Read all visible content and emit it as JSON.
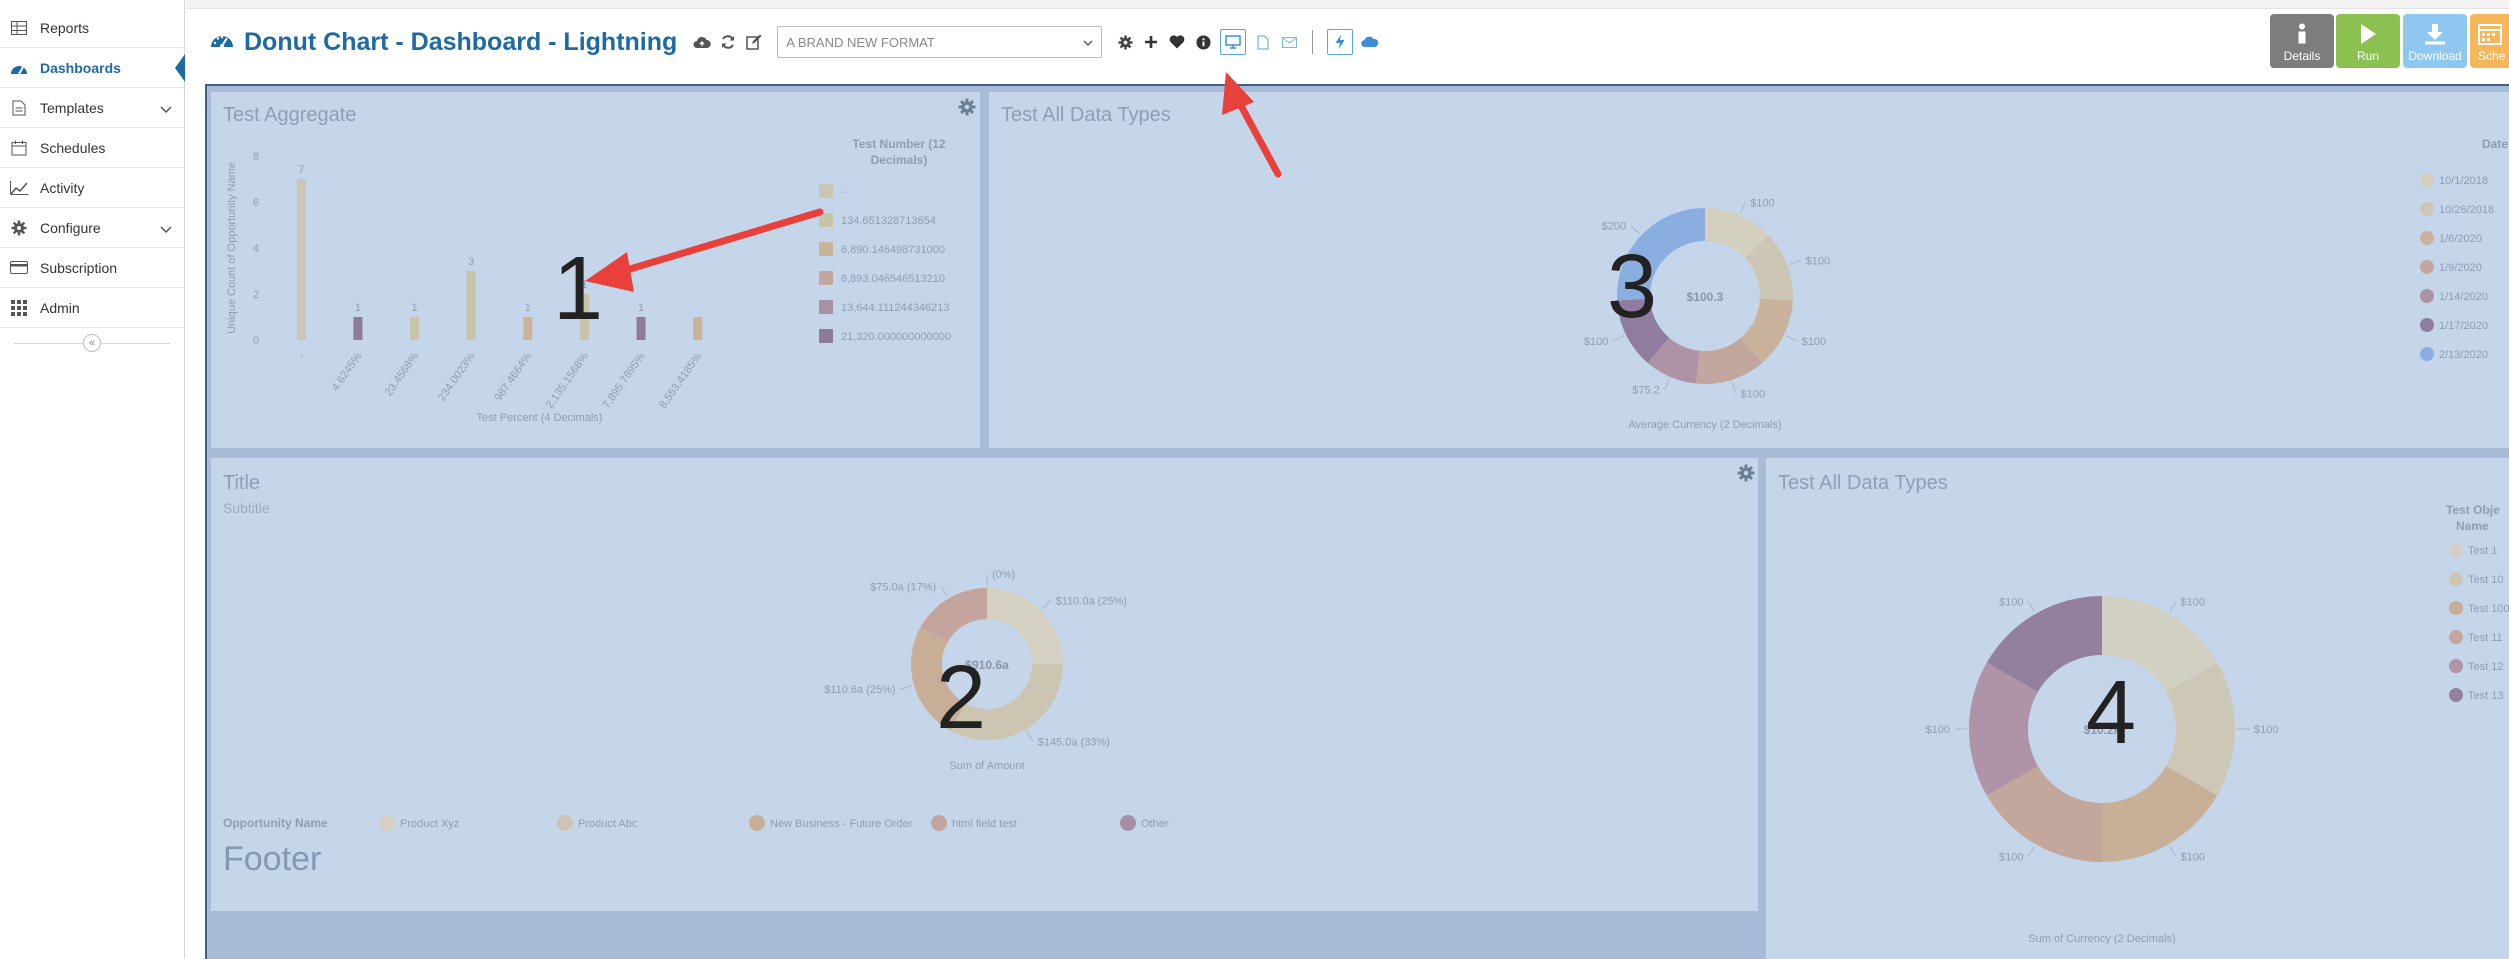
{
  "sidebar": {
    "items": [
      {
        "label": "Reports",
        "icon": "table-icon"
      },
      {
        "label": "Dashboards",
        "icon": "dashboard-icon",
        "active": true
      },
      {
        "label": "Templates",
        "icon": "document-icon",
        "expandable": true
      },
      {
        "label": "Schedules",
        "icon": "calendar-icon"
      },
      {
        "label": "Activity",
        "icon": "line-chart-icon"
      },
      {
        "label": "Configure",
        "icon": "gear-icon",
        "expandable": true
      },
      {
        "label": "Subscription",
        "icon": "credit-card-icon"
      },
      {
        "label": "Admin",
        "icon": "grid-icon"
      }
    ],
    "collapse_glyph": "«"
  },
  "header": {
    "title": "Donut Chart - Dashboard - Lightning",
    "format_select": {
      "value": "A BRAND NEW FORMAT"
    }
  },
  "actions": {
    "details": {
      "label": "Details",
      "color": "#7d7d7d"
    },
    "run": {
      "label": "Run",
      "color": "#8cc152"
    },
    "download": {
      "label": "Download",
      "color": "#8ec7ef"
    },
    "schedule": {
      "label": "Sche",
      "color": "#f5b75a"
    }
  },
  "colors": {
    "accent": "#1f6aa5",
    "dashboard_bg": "#a9bcd7",
    "panel_bg": "#c6d6ea",
    "annotation_arrow": "#e8403a"
  },
  "panels": {
    "p1": {
      "title": "Test Aggregate",
      "ylabel": "Unique Count of Opportunity Name",
      "xlabel": "Test Percent (4 Decimals)",
      "legend_title": "Test Number (12 Decimals)",
      "annotation": "1"
    },
    "p2": {
      "title": "Test All Data Types",
      "center_label": "$100.3",
      "xlabel": "Average Currency (2 Decimals)",
      "legend_title": "Date",
      "annotation": "3"
    },
    "p3": {
      "title": "Title",
      "subtitle": "Subtitle",
      "center_label": "$910.6a",
      "xlabel": "Sum of Amount",
      "legend_title": "Opportunity Name",
      "footer": "Footer",
      "annotation": "2"
    },
    "p4": {
      "title": "Test All Data Types",
      "center_label": "$10.2k",
      "xlabel": "Sum of Currency (2 Decimals)",
      "legend_title": "Test Obje Name",
      "annotation": "4"
    }
  },
  "chart_data": [
    {
      "type": "bar",
      "title": "Test Aggregate",
      "ylabel": "Unique Count of Opportunity Name",
      "xlabel": "Test Percent (4 Decimals)",
      "ylim": [
        0,
        8
      ],
      "yticks": [
        "0",
        "2",
        "4",
        "6",
        "8"
      ],
      "categories": [
        "-",
        "4.6245%",
        "23.4568%",
        "234.0023%",
        "987.4664%",
        "2,135.1568%",
        "7,895.7895%",
        "8,553.4185%"
      ],
      "series": [
        {
          "name": "-",
          "color": "#c9c7b3",
          "values": [
            7,
            0,
            0,
            0,
            0,
            0,
            0,
            0
          ]
        },
        {
          "name": "134.651328713654",
          "color": "#c8c4a8",
          "values": [
            0,
            0,
            1,
            3,
            0,
            2,
            0,
            0
          ]
        },
        {
          "name": "6,890.146498731000",
          "color": "#c9b49a",
          "values": [
            0,
            0,
            0,
            0,
            1,
            0,
            0,
            1
          ]
        },
        {
          "name": "6,893.046546513210",
          "color": "#c3a79e",
          "values": [
            0,
            0,
            0,
            0,
            0,
            0,
            0,
            0
          ]
        },
        {
          "name": "13,644.111244346213",
          "color": "#a890a6",
          "values": [
            0,
            0,
            0,
            0,
            0,
            0,
            0,
            0
          ]
        },
        {
          "name": "21,320.000000000000",
          "color": "#8e7b9c",
          "values": [
            0,
            1,
            0,
            0,
            0,
            0,
            1,
            0
          ]
        }
      ],
      "data_labels": [
        "7",
        "1",
        "1",
        "3",
        "1",
        "1",
        "1"
      ],
      "legend": "right"
    },
    {
      "type": "pie",
      "donut": true,
      "title": "Test All Data Types",
      "xlabel": "Average Currency (2 Decimals)",
      "center_label": "$100.3",
      "legend_title": "Date",
      "slices": [
        {
          "name": "10/1/2018",
          "label": "$100",
          "value": 100,
          "color": "#d4d0c0"
        },
        {
          "name": "10/26/2018",
          "label": "$100",
          "value": 100,
          "color": "#cec6b4"
        },
        {
          "name": "1/6/2020",
          "label": "$100",
          "value": 100,
          "color": "#c9b39c"
        },
        {
          "name": "1/9/2020",
          "label": "$100",
          "value": 100,
          "color": "#c3a79e"
        },
        {
          "name": "1/14/2020",
          "label": "$75.2",
          "value": 75.2,
          "color": "#ad93a5"
        },
        {
          "name": "1/17/2020",
          "label": "$100",
          "value": 100,
          "color": "#8f7c9e"
        },
        {
          "name": "2/13/2020",
          "label": "$200",
          "value": 200,
          "color": "#8aaee0"
        }
      ],
      "legend": "right"
    },
    {
      "type": "pie",
      "donut": true,
      "title": "Title",
      "subtitle": "Subtitle",
      "xlabel": "Sum of Amount",
      "center_label": "$910.6a",
      "legend_title": "Opportunity Name",
      "slices": [
        {
          "name": "Product Xyz",
          "label": "$110.0a (25%)",
          "value": 25,
          "color": "#d4d1c2"
        },
        {
          "name": "Product Abc",
          "label": "$145.0a (33%)",
          "value": 33,
          "color": "#ccc5b2"
        },
        {
          "name": "New Business - Future Order",
          "label": "$110.6a (25%)",
          "value": 25,
          "color": "#c8ae96"
        },
        {
          "name": "html field test",
          "label": "$75.0a (17%)",
          "value": 17,
          "color": "#c4a59d"
        },
        {
          "name": "Other",
          "label": "(0%)",
          "value": 0,
          "color": "#a68ea5"
        }
      ],
      "legend": "bottom"
    },
    {
      "type": "pie",
      "donut": true,
      "title": "Test All Data Types",
      "xlabel": "Sum of Currency (2 Decimals)",
      "center_label": "$10.2k",
      "legend_title": "Test Obje Name",
      "slices": [
        {
          "name": "Test 1",
          "label": "$100",
          "value": 100,
          "color": "#d2d0c3"
        },
        {
          "name": "Test 10",
          "label": "$100",
          "value": 100,
          "color": "#cdc8b6"
        },
        {
          "name": "Test 100",
          "label": "$100",
          "value": 100,
          "color": "#c8b098"
        },
        {
          "name": "Test 11",
          "label": "$100",
          "value": 100,
          "color": "#c3a69c"
        },
        {
          "name": "Test 12",
          "label": "$100",
          "value": 100,
          "color": "#ae94a6"
        },
        {
          "name": "Test 13",
          "label": "$100",
          "value": 100,
          "color": "#93809f"
        }
      ],
      "legend": "right"
    }
  ]
}
